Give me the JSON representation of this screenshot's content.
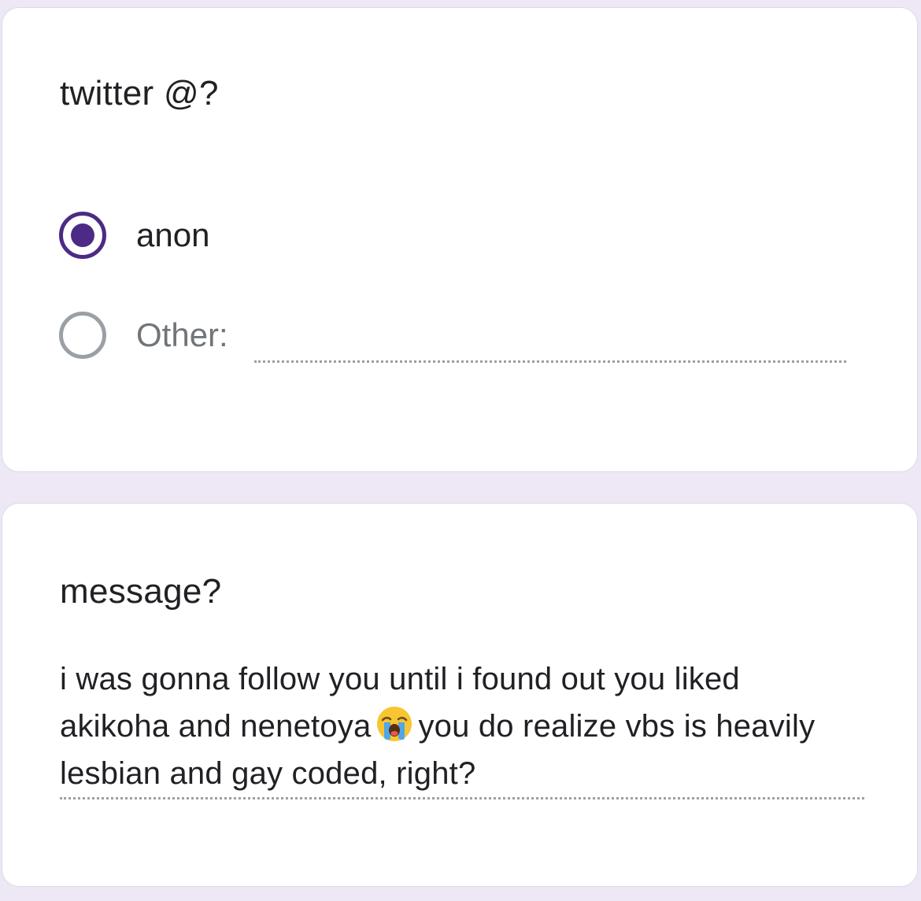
{
  "form": {
    "twitter_question": {
      "title": "twitter @?",
      "options": [
        {
          "label": "anon",
          "selected": true
        },
        {
          "label": "Other:",
          "selected": false,
          "value": ""
        }
      ]
    },
    "message_question": {
      "title": "message?",
      "answer_part1": "i was gonna follow you until i found out you liked akikoha and nenetoya",
      "answer_emoji": "loudly-crying-face-emoji",
      "answer_part2": "you do realize vbs is heavily lesbian and gay coded, right?"
    }
  },
  "colors": {
    "background": "#ede7f6",
    "card": "#ffffff",
    "accent": "#4c2a85",
    "muted": "#9aa0a6"
  }
}
